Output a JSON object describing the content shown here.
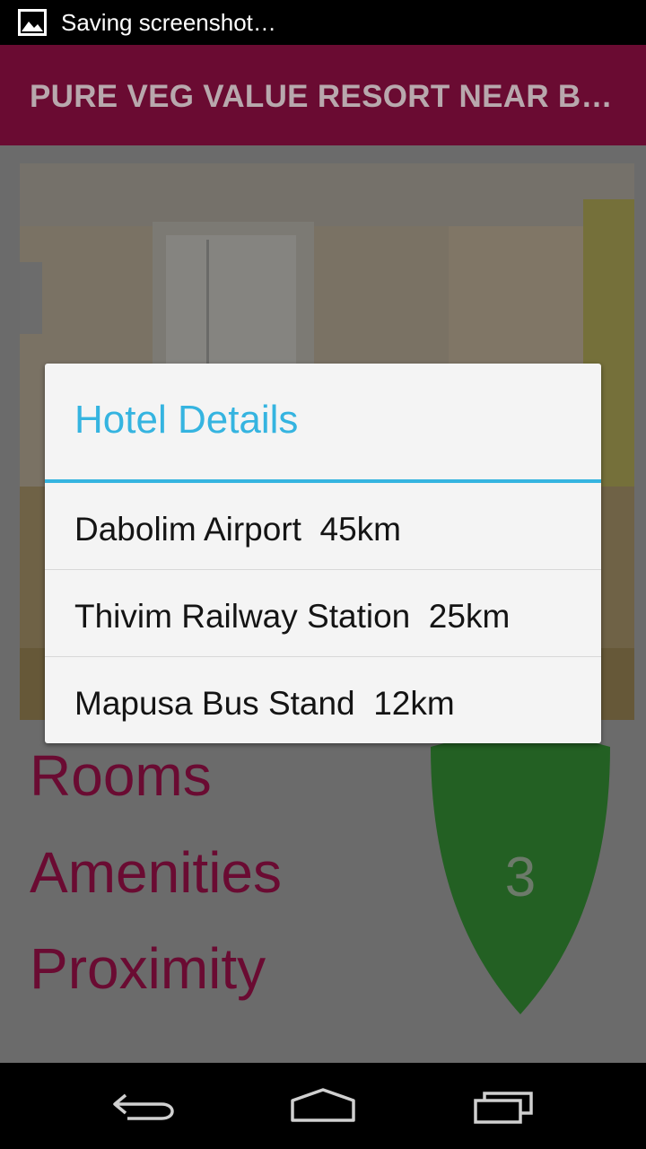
{
  "status_bar": {
    "notification_icon": "image-icon",
    "text": "Saving screenshot…"
  },
  "action_bar": {
    "title": "PURE VEG VALUE RESORT NEAR BA…",
    "color": "#6a0b32"
  },
  "menu": {
    "rooms": "Rooms",
    "amenities": "Amenities",
    "proximity": "Proximity"
  },
  "badge": {
    "value": "3",
    "icon": "shield-icon",
    "color": "#236023"
  },
  "dialog": {
    "title": "Hotel Details",
    "accent_color": "#35b4e0",
    "items": [
      {
        "label": "Dabolim Airport  45km"
      },
      {
        "label": "Thivim Railway Station  25km"
      },
      {
        "label": "Mapusa Bus Stand  12km"
      }
    ]
  },
  "nav_bar": {
    "back_icon": "back-icon",
    "home_icon": "home-icon",
    "recents_icon": "recents-icon"
  }
}
